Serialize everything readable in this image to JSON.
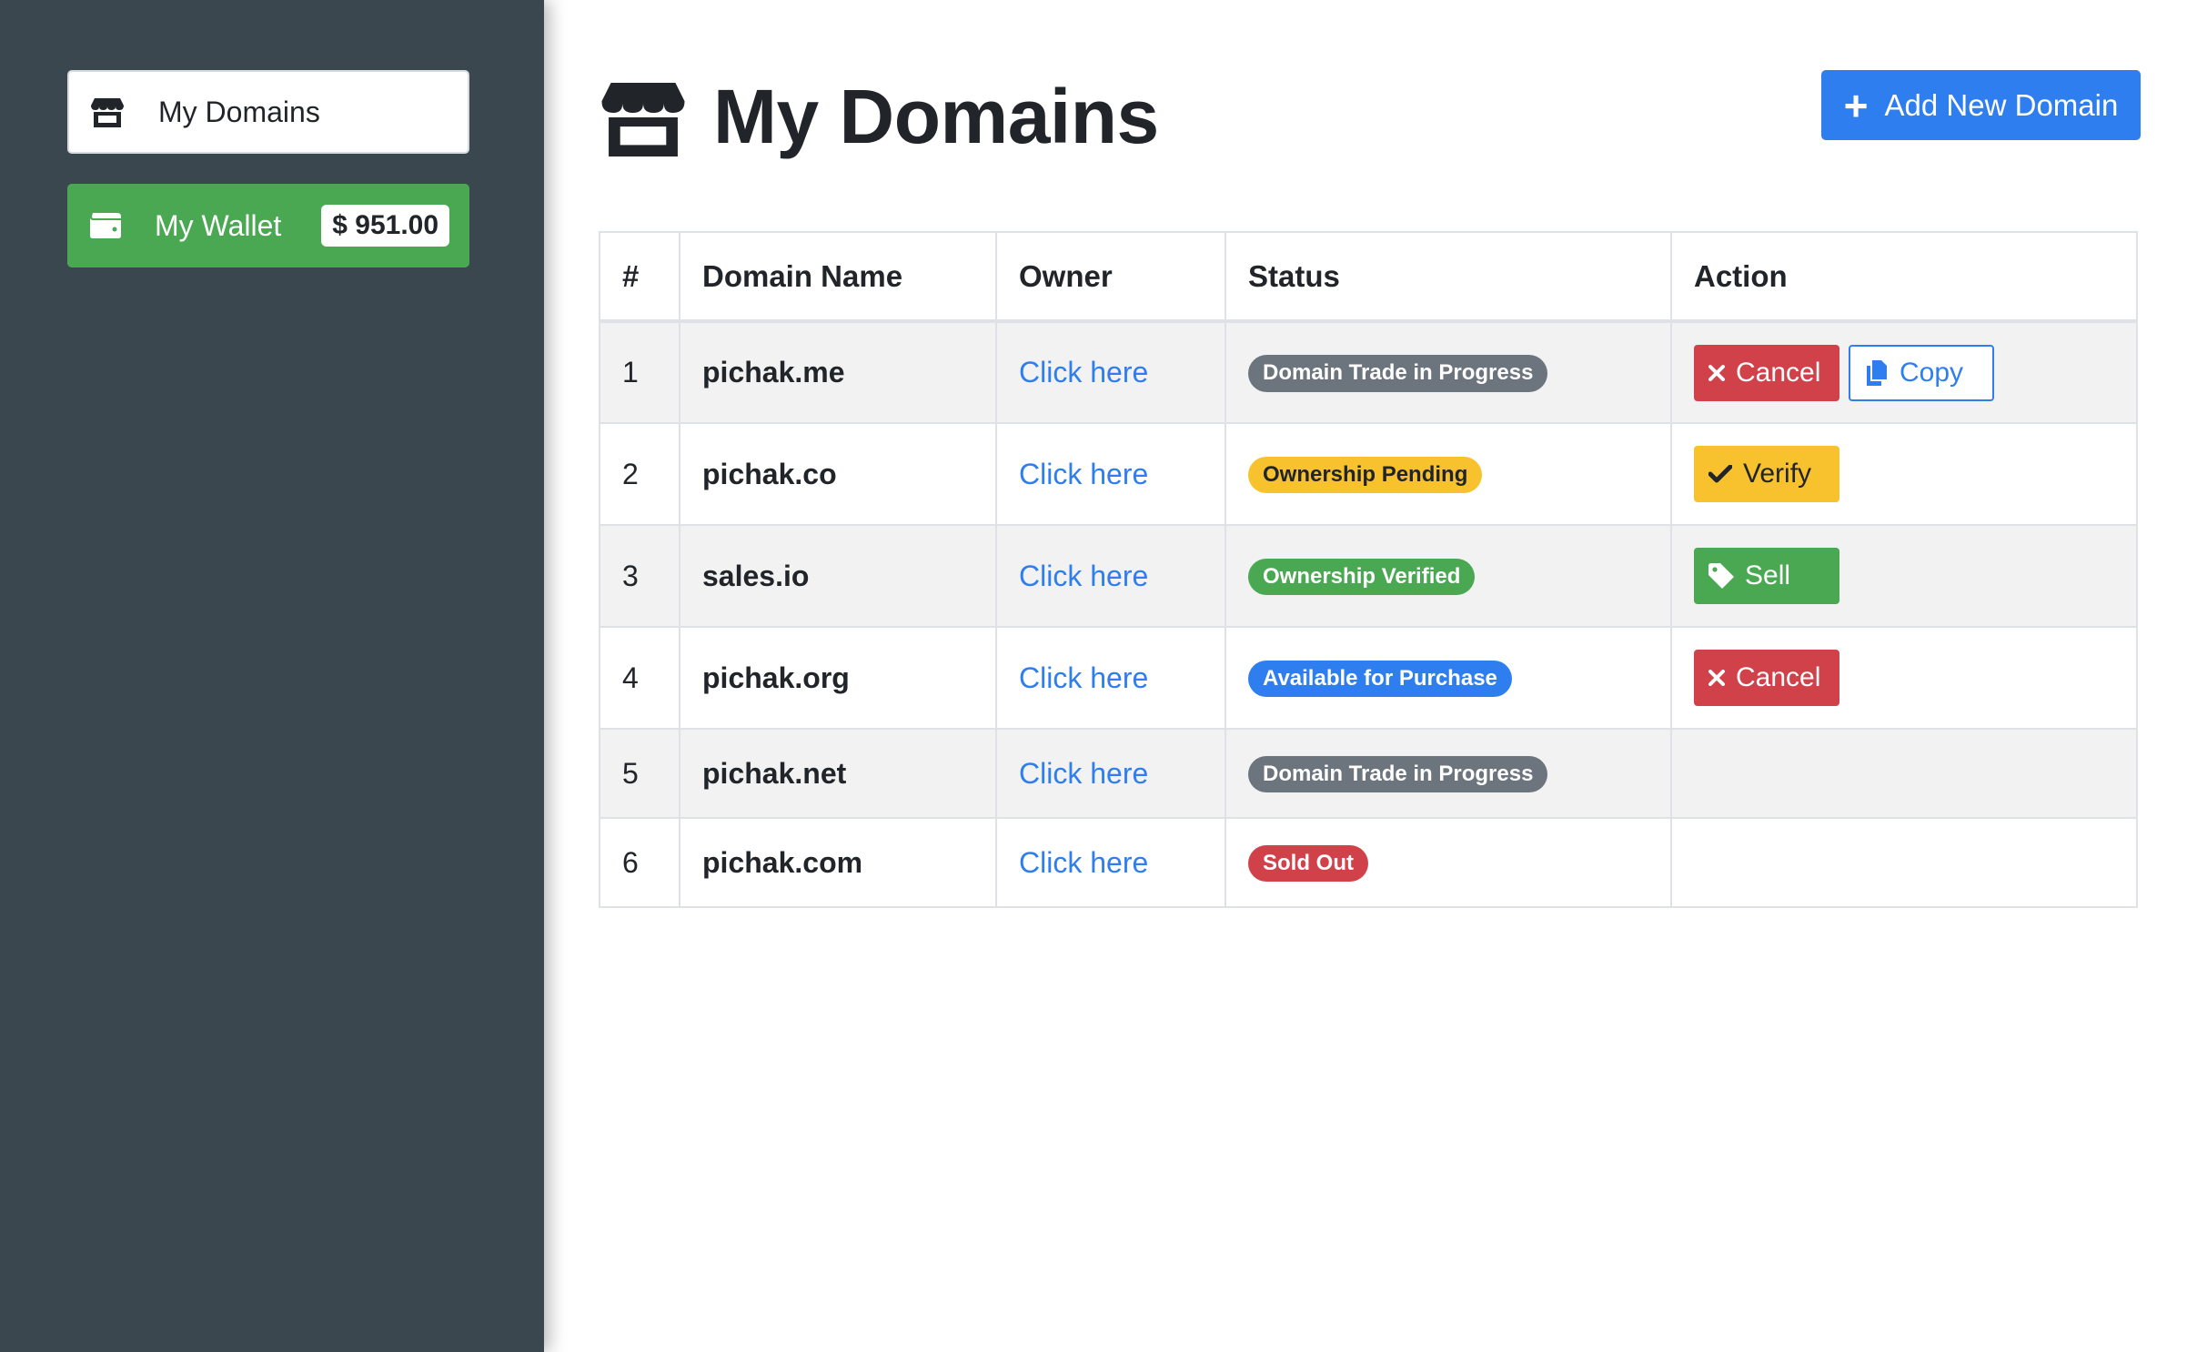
{
  "sidebar": {
    "domains_label": "My Domains",
    "wallet_label": "My Wallet",
    "wallet_balance": "$ 951.00"
  },
  "header": {
    "title": "My Domains",
    "add_button_label": "Add New Domain"
  },
  "table": {
    "headers": [
      "#",
      "Domain Name",
      "Owner",
      "Status",
      "Action"
    ],
    "rows": [
      {
        "num": "1",
        "domain": "pichak.me",
        "owner": "Click here",
        "status": "Domain Trade in Progress",
        "status_color": "#6c757d",
        "actions": [
          "Cancel",
          "Copy"
        ]
      },
      {
        "num": "2",
        "domain": "pichak.co",
        "owner": "Click here",
        "status": "Ownership Pending",
        "status_color": "#f7c22e",
        "actions": [
          "Verify"
        ]
      },
      {
        "num": "3",
        "domain": "sales.io",
        "owner": "Click here",
        "status": "Ownership Verified",
        "status_color": "#4aa852",
        "actions": [
          "Sell"
        ]
      },
      {
        "num": "4",
        "domain": "pichak.org",
        "owner": "Click here",
        "status": "Available for Purchase",
        "status_color": "#2e7ef0",
        "actions": [
          "Cancel"
        ]
      },
      {
        "num": "5",
        "domain": "pichak.net",
        "owner": "Click here",
        "status": "Domain Trade in Progress",
        "status_color": "#6c757d",
        "actions": []
      },
      {
        "num": "6",
        "domain": "pichak.com",
        "owner": "Click here",
        "status": "Sold Out",
        "status_color": "#d1414a",
        "actions": []
      }
    ]
  },
  "colors": {
    "sidebar_bg": "#3a474f",
    "primary": "#2e7ef0",
    "success": "#4aa852",
    "danger": "#d1414a",
    "warning": "#f7c22e",
    "secondary": "#6c757d"
  },
  "icons": {
    "domains": "store-icon",
    "wallet": "wallet-icon",
    "add": "plus-icon",
    "cancel": "x-icon",
    "copy": "copy-icon",
    "verify": "check-icon",
    "sell": "tag-icon"
  }
}
